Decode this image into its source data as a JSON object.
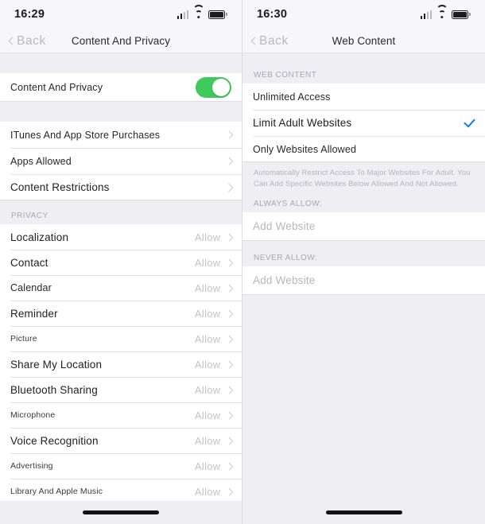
{
  "left": {
    "status": {
      "time": "16:29",
      "signal_icon": "cellular-signal-icon",
      "wifi_icon": "wifi-icon",
      "battery_icon": "battery-icon"
    },
    "nav": {
      "back_label": "Back",
      "title": "Content And Privacy"
    },
    "toggle_row": {
      "label": "Content And Privacy",
      "state": "on",
      "color": "#3fcb5b"
    },
    "menu_items": [
      {
        "label": "ITunes And App Store Purchases"
      },
      {
        "label": "Apps Allowed"
      },
      {
        "label": "Content Restrictions"
      }
    ],
    "privacy_header": "PRIVACY",
    "privacy_items": [
      {
        "label": "Localization",
        "value": "Allow"
      },
      {
        "label": "Contact",
        "value": "Allow"
      },
      {
        "label": "Calendar",
        "value": "Allow"
      },
      {
        "label": "Reminder",
        "value": "Allow"
      },
      {
        "label": "Picture",
        "value": "Allow"
      },
      {
        "label": "Share My Location",
        "value": "Allow"
      },
      {
        "label": "Bluetooth Sharing",
        "value": "Allow"
      },
      {
        "label": "Microphone",
        "value": "Allow"
      },
      {
        "label": "Voice Recognition",
        "value": "Allow"
      },
      {
        "label": "Advertising",
        "value": "Allow"
      },
      {
        "label": "Library And Apple Music",
        "value": "Allow"
      }
    ]
  },
  "right": {
    "status": {
      "time": "16:30",
      "signal_icon": "cellular-signal-icon",
      "wifi_icon": "wifi-icon",
      "battery_icon": "battery-icon"
    },
    "nav": {
      "back_label": "Back",
      "title": "Web Content"
    },
    "web_content_header": "WEB CONTENT",
    "options": [
      {
        "label": "Unlimited Access",
        "selected": false
      },
      {
        "label": "Limit Adult Websites",
        "selected": true
      },
      {
        "label": "Only Websites Allowed",
        "selected": false
      }
    ],
    "footer_note": "Automatically Restrict Access To Major Websites For Adult. You Can Add Specific Websites Below Allowed And Not Allowed.",
    "always_allow_header": "ALWAYS ALLOW:",
    "always_allow_action": "Add Website",
    "never_allow_header": "NEVER ALLOW:",
    "never_allow_action": "Add Website",
    "check_color": "#0b7ef2"
  }
}
